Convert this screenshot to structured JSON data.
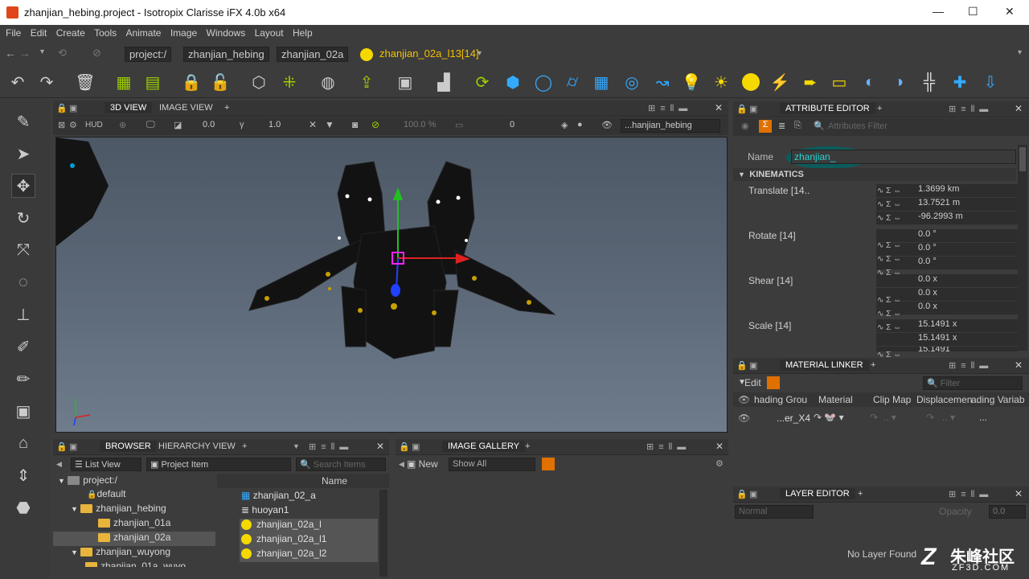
{
  "window": {
    "title": "zhanjian_hebing.project - Isotropix Clarisse iFX 4.0b x64",
    "min": "—",
    "max": "☐",
    "close": "✕"
  },
  "menu": [
    "File",
    "Edit",
    "Create",
    "Tools",
    "Animate",
    "Image",
    "Windows",
    "Layout",
    "Help"
  ],
  "path": {
    "root": "project:/",
    "c1": "zhanjian_hebing",
    "c2": "zhanjian_02a",
    "current": "zhanjian_02a_l13[14]"
  },
  "viewport_panel": {
    "tabs": [
      "3D VIEW",
      "IMAGE VIEW"
    ],
    "add": "+",
    "hud": "HUD",
    "val1": "0.0",
    "val2": "1.0",
    "percent": "100.0 %",
    "frame": "0",
    "context": "...hanjian_hebing"
  },
  "attribute_editor": {
    "tab": "ATTRIBUTE EDITOR",
    "add": "+",
    "filter_placeholder": "Attributes Filter",
    "name_label": "Name",
    "name_value": "zhanjian_",
    "section": "KINEMATICS",
    "groups": [
      {
        "label": "Translate [14..",
        "values": [
          "1.3699 km",
          "13.7521 m",
          "-96.2993 m"
        ]
      },
      {
        "label": "Rotate [14]",
        "values": [
          "0.0 °",
          "0.0 °",
          "0.0 °"
        ]
      },
      {
        "label": "Shear [14]",
        "values": [
          "0.0 x",
          "0.0 x",
          "0.0 x"
        ]
      },
      {
        "label": "Scale [14]",
        "values": [
          "15.1491 x",
          "15.1491 x",
          "15.1491"
        ]
      }
    ]
  },
  "material_linker": {
    "tab": "MATERIAL LINKER",
    "add": "+",
    "edit": "Edit",
    "filter_placeholder": "Filter",
    "columns": [
      "hading Grou",
      "Material",
      "Clip Map",
      "Displacemen",
      "ading Variab"
    ],
    "row": {
      "group": "...er_X4",
      "more": "..."
    }
  },
  "layer_editor": {
    "tab": "LAYER EDITOR",
    "add": "+",
    "mode": "Normal",
    "opacity_label": "Opacity",
    "opacity": "0.0",
    "empty": "No Layer Found"
  },
  "browser": {
    "tabs": [
      "BROWSER",
      "HIERARCHY VIEW"
    ],
    "add": "+",
    "view_mode": "List View",
    "item_type": "Project Item",
    "search_placeholder": "Search Items",
    "tree": [
      "project:/",
      "default",
      "zhanjian_hebing",
      "zhanjian_01a",
      "zhanjian_02a",
      "zhanjian_wuyong",
      "zhanjian_01a_wuyo"
    ],
    "col_name": "Name",
    "items": [
      {
        "label": "zhanjian_02_a",
        "icon": "grid-icon"
      },
      {
        "label": "huoyan1",
        "icon": "list-icon"
      },
      {
        "label": "zhanjian_02a_l",
        "icon": "dot"
      },
      {
        "label": "zhanjian_02a_l1",
        "icon": "dot"
      },
      {
        "label": "zhanjian_02a_l2",
        "icon": "dot"
      }
    ]
  },
  "image_gallery": {
    "tab": "IMAGE GALLERY",
    "add": "+",
    "new": "New",
    "show": "Show All"
  },
  "watermark": {
    "brand": "朱峰社区",
    "url": "ZF3D.COM"
  },
  "colors": {
    "accent": "#f5d800",
    "panel": "#3c3c3c",
    "dark": "#2b2b2b",
    "gizmo_red": "#e02020",
    "gizmo_green": "#20c020",
    "gizmo_blue": "#2040ff"
  }
}
